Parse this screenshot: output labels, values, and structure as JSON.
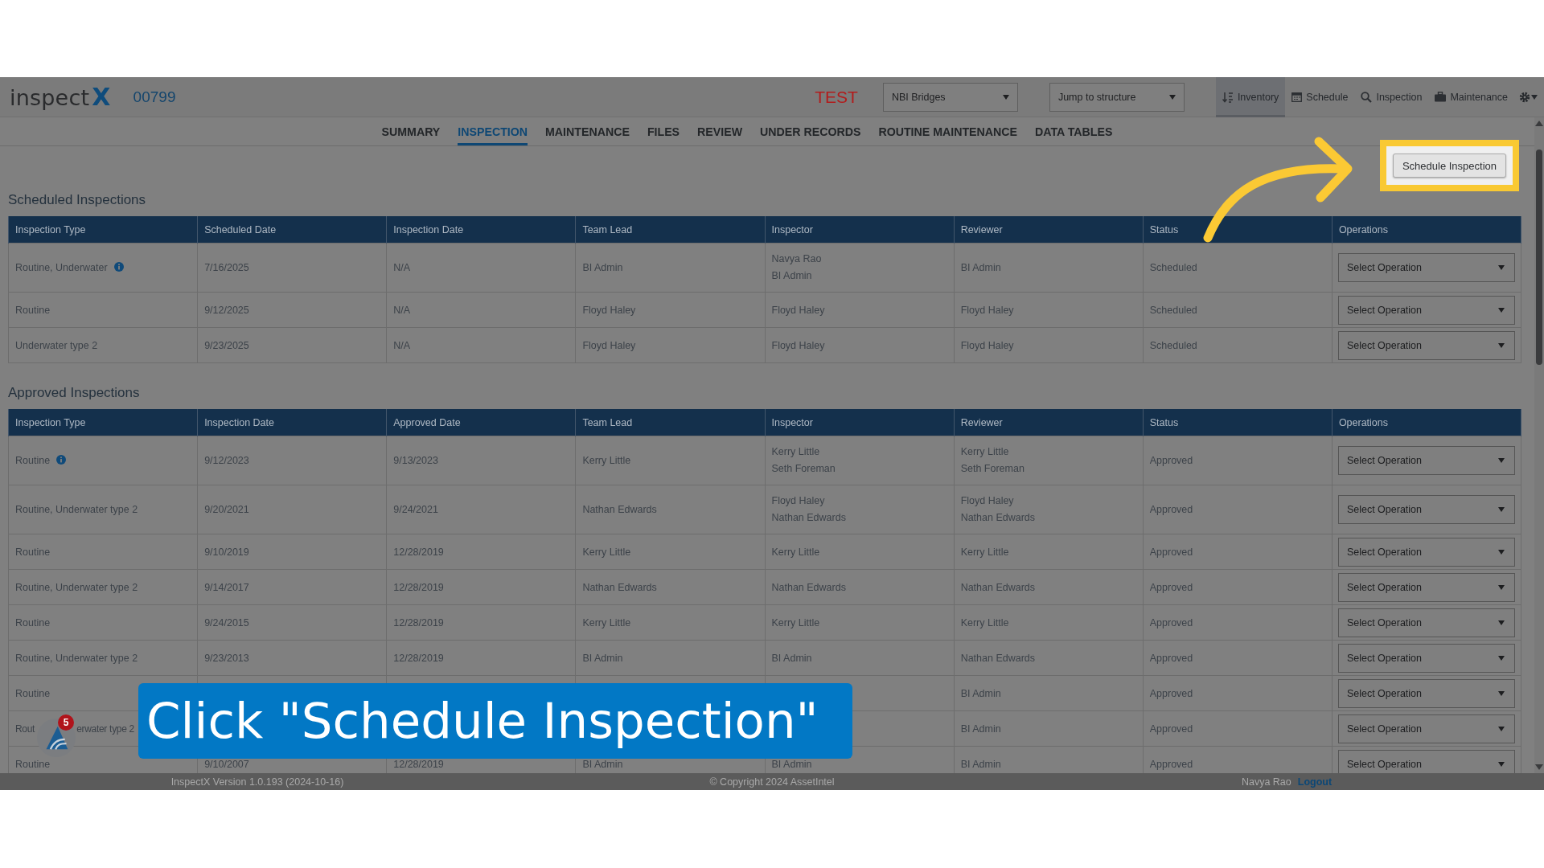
{
  "header": {
    "logo": {
      "word": "inspect",
      "mark": "X"
    },
    "structure_id": "00799",
    "environment": "TEST",
    "dropdowns": [
      {
        "value": "NBI Bridges"
      },
      {
        "value": "Jump to structure"
      }
    ],
    "nav": [
      {
        "label": "Inventory",
        "kind": "sort",
        "selected": true
      },
      {
        "label": "Schedule",
        "kind": "calendar",
        "selected": false
      },
      {
        "label": "Inspection",
        "kind": "search",
        "selected": false
      },
      {
        "label": "Maintenance",
        "kind": "briefcase",
        "selected": false
      }
    ]
  },
  "tabs": [
    {
      "label": "SUMMARY",
      "selected": false
    },
    {
      "label": "INSPECTION",
      "selected": true
    },
    {
      "label": "MAINTENANCE",
      "selected": false
    },
    {
      "label": "FILES",
      "selected": false
    },
    {
      "label": "REVIEW",
      "selected": false
    },
    {
      "label": "UNDER RECORDS",
      "selected": false
    },
    {
      "label": "ROUTINE MAINTENANCE",
      "selected": false
    },
    {
      "label": "DATA TABLES",
      "selected": false
    }
  ],
  "schedule_button": {
    "label": "Schedule Inspection"
  },
  "sections": [
    {
      "title": "Scheduled Inspections",
      "columns": [
        "Inspection Type",
        "Scheduled Date",
        "Inspection Date",
        "Team Lead",
        "Inspector",
        "Reviewer",
        "Status",
        "Operations"
      ],
      "rows": [
        {
          "info": true,
          "cells": [
            "Routine, Underwater",
            "7/16/2025",
            "N/A",
            "BI Admin",
            [
              "Navya Rao",
              "BI Admin"
            ],
            "BI Admin",
            "Scheduled"
          ],
          "operation": "Select Operation"
        },
        {
          "info": false,
          "cells": [
            "Routine",
            "9/12/2025",
            "N/A",
            "Floyd Haley",
            "Floyd Haley",
            "Floyd Haley",
            "Scheduled"
          ],
          "operation": "Select Operation"
        },
        {
          "info": false,
          "cells": [
            "Underwater type 2",
            "9/23/2025",
            "N/A",
            "Floyd Haley",
            "Floyd Haley",
            "Floyd Haley",
            "Scheduled"
          ],
          "operation": "Select Operation"
        }
      ]
    },
    {
      "title": "Approved Inspections",
      "columns": [
        "Inspection Type",
        "Inspection Date",
        "Approved Date",
        "Team Lead",
        "Inspector",
        "Reviewer",
        "Status",
        "Operations"
      ],
      "rows": [
        {
          "info": true,
          "cells": [
            "Routine",
            "9/12/2023",
            "9/13/2023",
            "Kerry Little",
            [
              "Kerry Little",
              "Seth Foreman"
            ],
            [
              "Kerry Little",
              "Seth Foreman"
            ],
            "Approved"
          ],
          "operation": "Select Operation"
        },
        {
          "info": false,
          "cells": [
            "Routine, Underwater type 2",
            "9/20/2021",
            "9/24/2021",
            "Nathan Edwards",
            [
              "Floyd Haley",
              "Nathan Edwards"
            ],
            [
              "Floyd Haley",
              "Nathan Edwards"
            ],
            "Approved"
          ],
          "operation": "Select Operation"
        },
        {
          "info": false,
          "cells": [
            "Routine",
            "9/10/2019",
            "12/28/2019",
            "Kerry Little",
            "Kerry Little",
            "Kerry Little",
            "Approved"
          ],
          "operation": "Select Operation"
        },
        {
          "info": false,
          "cells": [
            "Routine, Underwater type 2",
            "9/14/2017",
            "12/28/2019",
            "Nathan Edwards",
            "Nathan Edwards",
            "Nathan Edwards",
            "Approved"
          ],
          "operation": "Select Operation"
        },
        {
          "info": false,
          "cells": [
            "Routine",
            "9/24/2015",
            "12/28/2019",
            "Kerry Little",
            "Kerry Little",
            "Kerry Little",
            "Approved"
          ],
          "operation": "Select Operation"
        },
        {
          "info": false,
          "cells": [
            "Routine, Underwater type 2",
            "9/23/2013",
            "12/28/2019",
            "BI Admin",
            "BI Admin",
            "Nathan Edwards",
            "Approved"
          ],
          "operation": "Select Operation"
        },
        {
          "info": false,
          "cells": [
            "Routine",
            null,
            null,
            null,
            null,
            "BI Admin",
            "Approved"
          ],
          "operation": "Select Operation"
        },
        {
          "info": false,
          "cells": [
            {
              "pieces": [
                "Rout",
                "erwater type 2"
              ]
            },
            null,
            null,
            null,
            null,
            "BI Admin",
            "Approved"
          ],
          "operation": "Select Operation"
        },
        {
          "info": false,
          "cells": [
            "Routine",
            "9/10/2007",
            "12/28/2019",
            "BI Admin",
            "BI Admin",
            "BI Admin",
            "Approved"
          ],
          "operation": "Select Operation"
        }
      ]
    }
  ],
  "footer": {
    "version": "InspectX Version 1.0.193 (2024-10-16)",
    "copyright": "© Copyright 2024 AssetIntel",
    "user": "Navya Rao",
    "logout": "Logout"
  },
  "help_widget": {
    "badge": "5"
  },
  "caption": {
    "text": "Click \"Schedule Inspection\""
  }
}
